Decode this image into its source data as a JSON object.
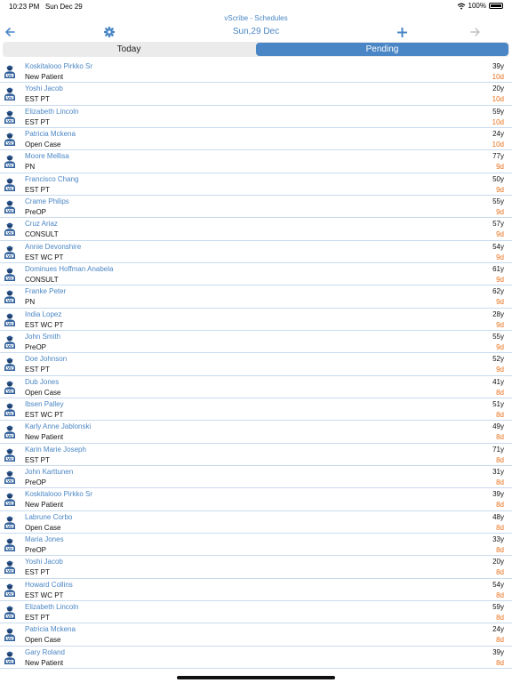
{
  "status": {
    "time": "10:23 PM",
    "date": "Sun Dec 29",
    "battery": "100%"
  },
  "app": {
    "title": "vScribe - Schedules"
  },
  "nav": {
    "date_title": "Sun,29 Dec"
  },
  "tabs": [
    {
      "label": "Today",
      "active": false
    },
    {
      "label": "Pending",
      "active": true
    }
  ],
  "colors": {
    "accent": "#4a86c5",
    "days_overdue": "#e8701a",
    "divider": "#c9dbee"
  },
  "patients": [
    {
      "name": "Koskitalooo Pirkko Sr",
      "visit": "New Patient",
      "age": "39y",
      "days": "10d"
    },
    {
      "name": "Yoshi Jacob",
      "visit": "EST PT",
      "age": "20y",
      "days": "10d"
    },
    {
      "name": "Elizabeth Lincoln",
      "visit": "EST PT",
      "age": "59y",
      "days": "10d"
    },
    {
      "name": "Patricia Mckena",
      "visit": "Open Case",
      "age": "24y",
      "days": "10d"
    },
    {
      "name": "Moore Mellisa",
      "visit": "PN",
      "age": "77y",
      "days": "9d"
    },
    {
      "name": "Francisco Chang",
      "visit": "EST PT",
      "age": "50y",
      "days": "9d"
    },
    {
      "name": "Crame Philips",
      "visit": "PreOP",
      "age": "55y",
      "days": "9d"
    },
    {
      "name": "Cruz Ariaz",
      "visit": "CONSULT",
      "age": "57y",
      "days": "9d"
    },
    {
      "name": "Annie Devonshire",
      "visit": "EST WC PT",
      "age": "54y",
      "days": "9d"
    },
    {
      "name": "Dominues Hoffman Anabela",
      "visit": "CONSULT",
      "age": "61y",
      "days": "9d"
    },
    {
      "name": "Franke Peter",
      "visit": "PN",
      "age": "62y",
      "days": "9d"
    },
    {
      "name": "India Lopez",
      "visit": "EST WC PT",
      "age": "28y",
      "days": "9d"
    },
    {
      "name": "John Smith",
      "visit": "PreOP",
      "age": "55y",
      "days": "9d"
    },
    {
      "name": "Doe Johnson",
      "visit": "EST PT",
      "age": "52y",
      "days": "9d"
    },
    {
      "name": "Dub Jones",
      "visit": "Open Case",
      "age": "41y",
      "days": "8d"
    },
    {
      "name": "Ibsen Palley",
      "visit": "EST WC PT",
      "age": "51y",
      "days": "8d"
    },
    {
      "name": "Karly Anne Jablonski",
      "visit": "New Patient",
      "age": "49y",
      "days": "8d"
    },
    {
      "name": "Karin Marie Joseph",
      "visit": "EST PT",
      "age": "71y",
      "days": "8d"
    },
    {
      "name": "John Karttunen",
      "visit": "PreOP",
      "age": "31y",
      "days": "8d"
    },
    {
      "name": "Koskitalooo Pirkko Sr",
      "visit": "New Patient",
      "age": "39y",
      "days": "8d"
    },
    {
      "name": "Labrune Corbo",
      "visit": "Open Case",
      "age": "48y",
      "days": "8d"
    },
    {
      "name": "Maria Jones",
      "visit": "PreOP",
      "age": "33y",
      "days": "8d"
    },
    {
      "name": "Yoshi Jacob",
      "visit": "EST PT",
      "age": "20y",
      "days": "8d"
    },
    {
      "name": "Howard Collins",
      "visit": "EST WC PT",
      "age": "54y",
      "days": "8d"
    },
    {
      "name": "Elizabeth Lincoln",
      "visit": "EST PT",
      "age": "59y",
      "days": "8d"
    },
    {
      "name": "Patricia Mckena",
      "visit": "Open Case",
      "age": "24y",
      "days": "8d"
    },
    {
      "name": "Gary Roland",
      "visit": "New Patient",
      "age": "39y",
      "days": "8d"
    }
  ]
}
